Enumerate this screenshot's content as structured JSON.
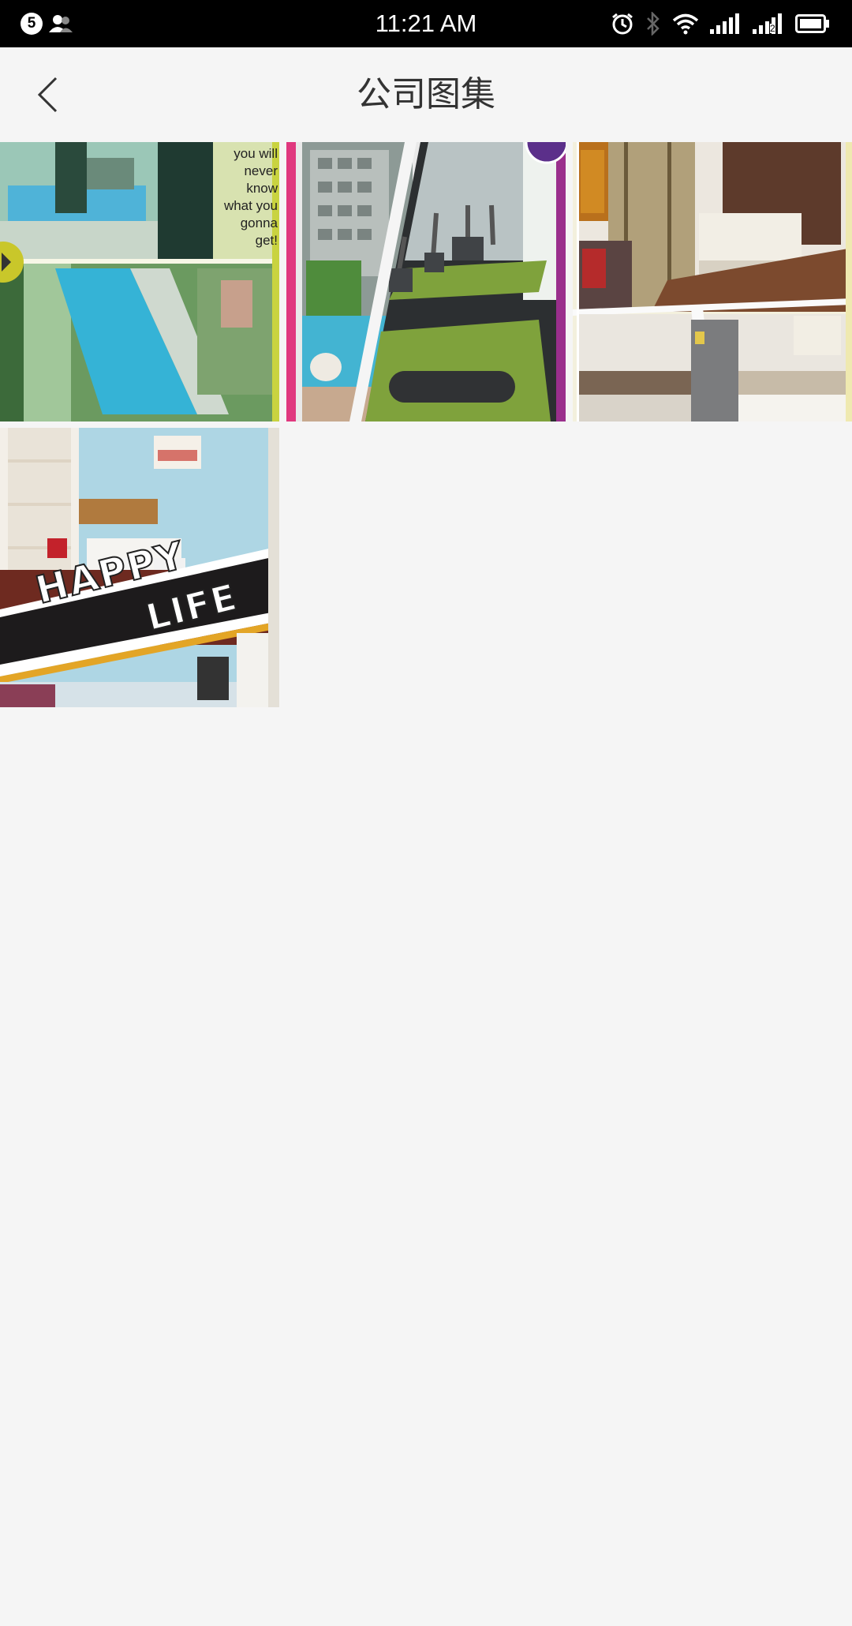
{
  "status_bar": {
    "time": "11:21 AM",
    "notification_count": "5",
    "icons": [
      "person-icon",
      "alarm-icon",
      "bluetooth-icon",
      "wifi-icon",
      "signal-icon",
      "signal-2-icon",
      "battery-icon"
    ],
    "signal_2_label": "2"
  },
  "app_bar": {
    "title": "公司图集",
    "back_icon": "chevron-left-icon"
  },
  "gallery": {
    "images": [
      {
        "name": "pool-collage",
        "caption_lines": [
          "you will",
          "never know",
          "what you",
          "gonna get!"
        ]
      },
      {
        "name": "gym-collage"
      },
      {
        "name": "bedroom-kitchen-collage"
      },
      {
        "name": "happy-life-room",
        "overlay_text_1": "HAPPY",
        "overlay_text_2": "LIFE"
      }
    ]
  },
  "colors": {
    "status_bar_bg": "#000000",
    "app_bg": "#f5f5f5",
    "title_text": "#333333"
  }
}
